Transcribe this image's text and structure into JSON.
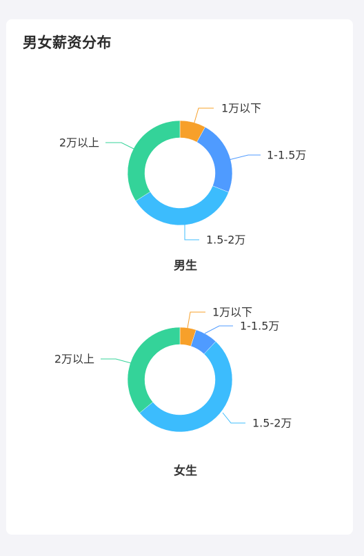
{
  "title": "男女薪资分布",
  "chart_data": [
    {
      "type": "pie",
      "title": "男生",
      "categories": [
        "1万以下",
        "1-1.5万",
        "1.5-2万",
        "2万以上"
      ],
      "values": [
        8,
        23,
        35,
        34
      ],
      "colors": [
        "#f7a02a",
        "#4f9bff",
        "#3cbcfd",
        "#34d399"
      ]
    },
    {
      "type": "pie",
      "title": "女生",
      "categories": [
        "1万以下",
        "1-1.5万",
        "1.5-2万",
        "2万以上"
      ],
      "values": [
        5,
        7,
        52,
        36
      ],
      "colors": [
        "#f7a02a",
        "#4f9bff",
        "#3cbcfd",
        "#34d399"
      ]
    }
  ]
}
